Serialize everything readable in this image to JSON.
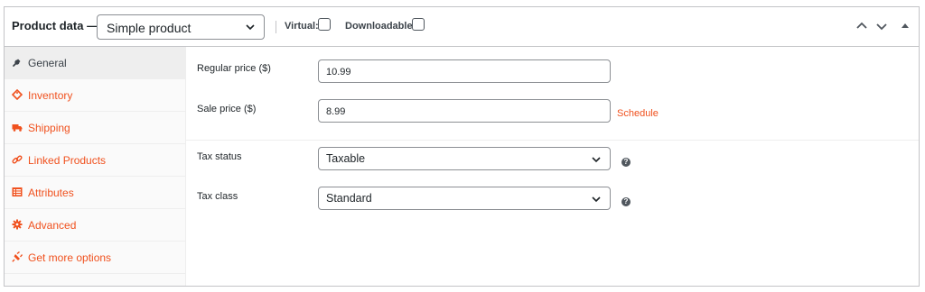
{
  "header": {
    "title": "Product data —",
    "product_type": "Simple product",
    "virtual_label": "Virtual:",
    "downloadable_label": "Downloadable:",
    "icons": [
      "chevron-up-icon",
      "chevron-down-icon",
      "triangle-up-icon"
    ]
  },
  "sidebar": {
    "active": "General",
    "items": [
      {
        "label": "General",
        "icon": "wrench-icon"
      },
      {
        "label": "Inventory",
        "icon": "tag-icon"
      },
      {
        "label": "Shipping",
        "icon": "truck-icon"
      },
      {
        "label": "Linked Products",
        "icon": "link-icon"
      },
      {
        "label": "Attributes",
        "icon": "list-icon"
      },
      {
        "label": "Advanced",
        "icon": "gear-icon"
      },
      {
        "label": "Get more options",
        "icon": "plug-icon"
      }
    ]
  },
  "pricing": {
    "regular_price_label": "Regular price ($)",
    "regular_price_value": "10.99",
    "sale_price_label": "Sale price ($)",
    "sale_price_value": "8.99",
    "schedule_label": "Schedule"
  },
  "tax": {
    "status_label": "Tax status",
    "status_value": "Taxable",
    "class_label": "Tax class",
    "class_value": "Standard",
    "help_glyph": "?"
  },
  "colors": {
    "accent": "#f0511e",
    "border": "#c3c4c7",
    "sidebar_bg": "#fafafa",
    "active_tab_bg": "#eeeeee"
  }
}
